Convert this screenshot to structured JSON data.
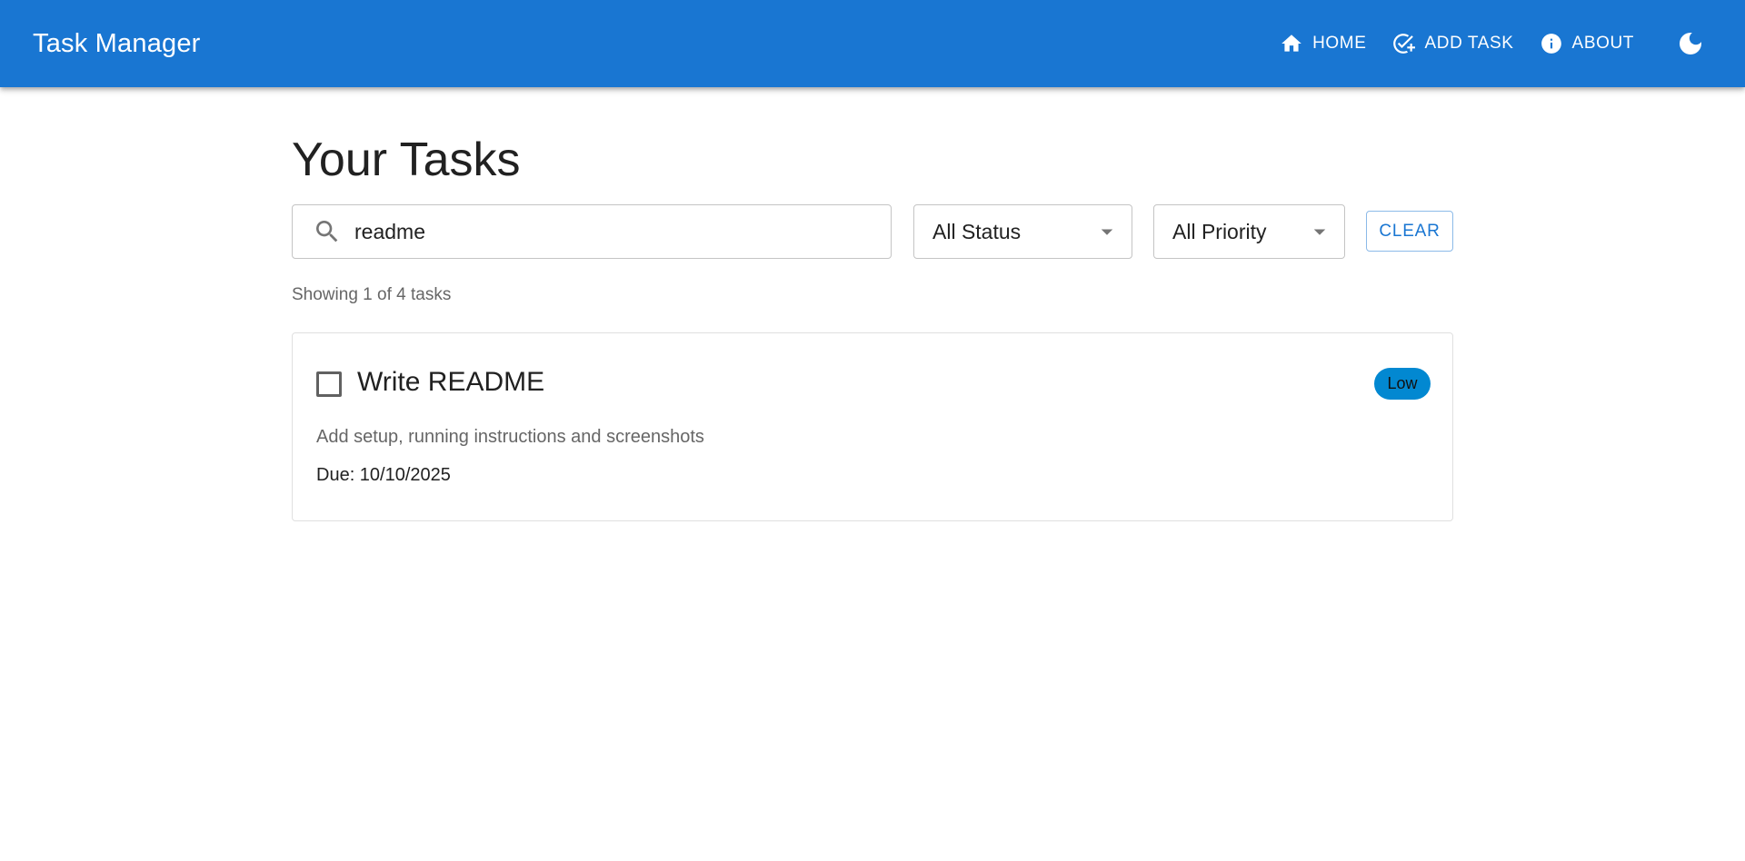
{
  "app": {
    "title": "Task Manager"
  },
  "nav": {
    "items": [
      {
        "label": "HOME",
        "icon": "home-icon"
      },
      {
        "label": "ADD TASK",
        "icon": "add-task-icon"
      },
      {
        "label": "ABOUT",
        "icon": "info-icon"
      }
    ],
    "theme_toggle_icon": "moon-icon"
  },
  "page": {
    "title": "Your Tasks"
  },
  "filters": {
    "search": {
      "value": "readme",
      "icon": "search-icon"
    },
    "status": {
      "selected": "All Status"
    },
    "priority": {
      "selected": "All Priority"
    },
    "clear_label": "CLEAR"
  },
  "results": {
    "summary": "Showing 1 of 4 tasks"
  },
  "tasks": [
    {
      "title": "Write README",
      "description": "Add setup, running instructions and screenshots",
      "due": "Due: 10/10/2025",
      "priority": "Low",
      "completed": false
    }
  ],
  "colors": {
    "primary": "#1976d2",
    "badge_low": "#0288d1",
    "border": "#c4c4c4"
  }
}
